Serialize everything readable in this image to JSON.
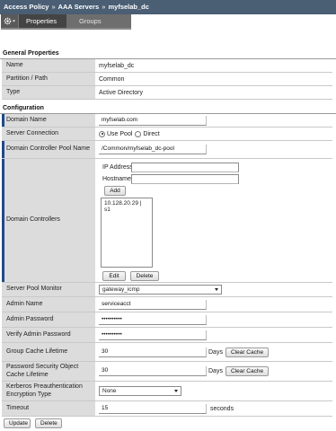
{
  "breadcrumb": {
    "part1": "Access Policy",
    "part2": "AAA Servers",
    "part3": "myfselab_dc",
    "separator": "»"
  },
  "tabs": {
    "properties": "Properties",
    "groups": "Groups",
    "menu_icon": "gear-icon"
  },
  "general": {
    "title": "General Properties",
    "name_label": "Name",
    "name_value": "myfselab_dc",
    "partition_label": "Partition / Path",
    "partition_value": "Common",
    "type_label": "Type",
    "type_value": "Active Directory"
  },
  "config": {
    "title": "Configuration",
    "domain_name_label": "Domain Name",
    "domain_name_value": "myfselab.com",
    "server_connection_label": "Server Connection",
    "use_pool_label": "Use Pool",
    "direct_label": "Direct",
    "dc_pool_name_label": "Domain Controller Pool Name",
    "dc_pool_name_value": "/Common/myfselab_dc-pool",
    "domain_controllers_label": "Domain Controllers",
    "ip_address_label": "IP Address:",
    "hostname_label": "Hostname:",
    "add_button": "Add",
    "dc_list": [
      "10.128.20.29 | s1"
    ],
    "edit_button": "Edit",
    "delete_button": "Delete",
    "server_pool_monitor_label": "Server Pool Monitor",
    "server_pool_monitor_value": "gateway_icmp",
    "admin_name_label": "Admin Name",
    "admin_name_value": "serviceacct",
    "admin_password_label": "Admin Password",
    "admin_password_value": "••••••••••",
    "verify_admin_password_label": "Verify Admin Password",
    "verify_admin_password_value": "••••••••••",
    "group_cache_label": "Group Cache Lifetime",
    "group_cache_value": "30",
    "group_cache_unit": "Days",
    "group_cache_clear": "Clear Cache",
    "pso_cache_label": "Password Security Object Cache Lifetime",
    "pso_cache_value": "30",
    "pso_cache_unit": "Days",
    "pso_cache_clear": "Clear Cache",
    "kerberos_label": "Kerberos Preauthentication Encryption Type",
    "kerberos_value": "None",
    "timeout_label": "Timeout",
    "timeout_value": "15",
    "timeout_unit": "seconds"
  },
  "actions": {
    "update": "Update",
    "delete": "Delete"
  }
}
